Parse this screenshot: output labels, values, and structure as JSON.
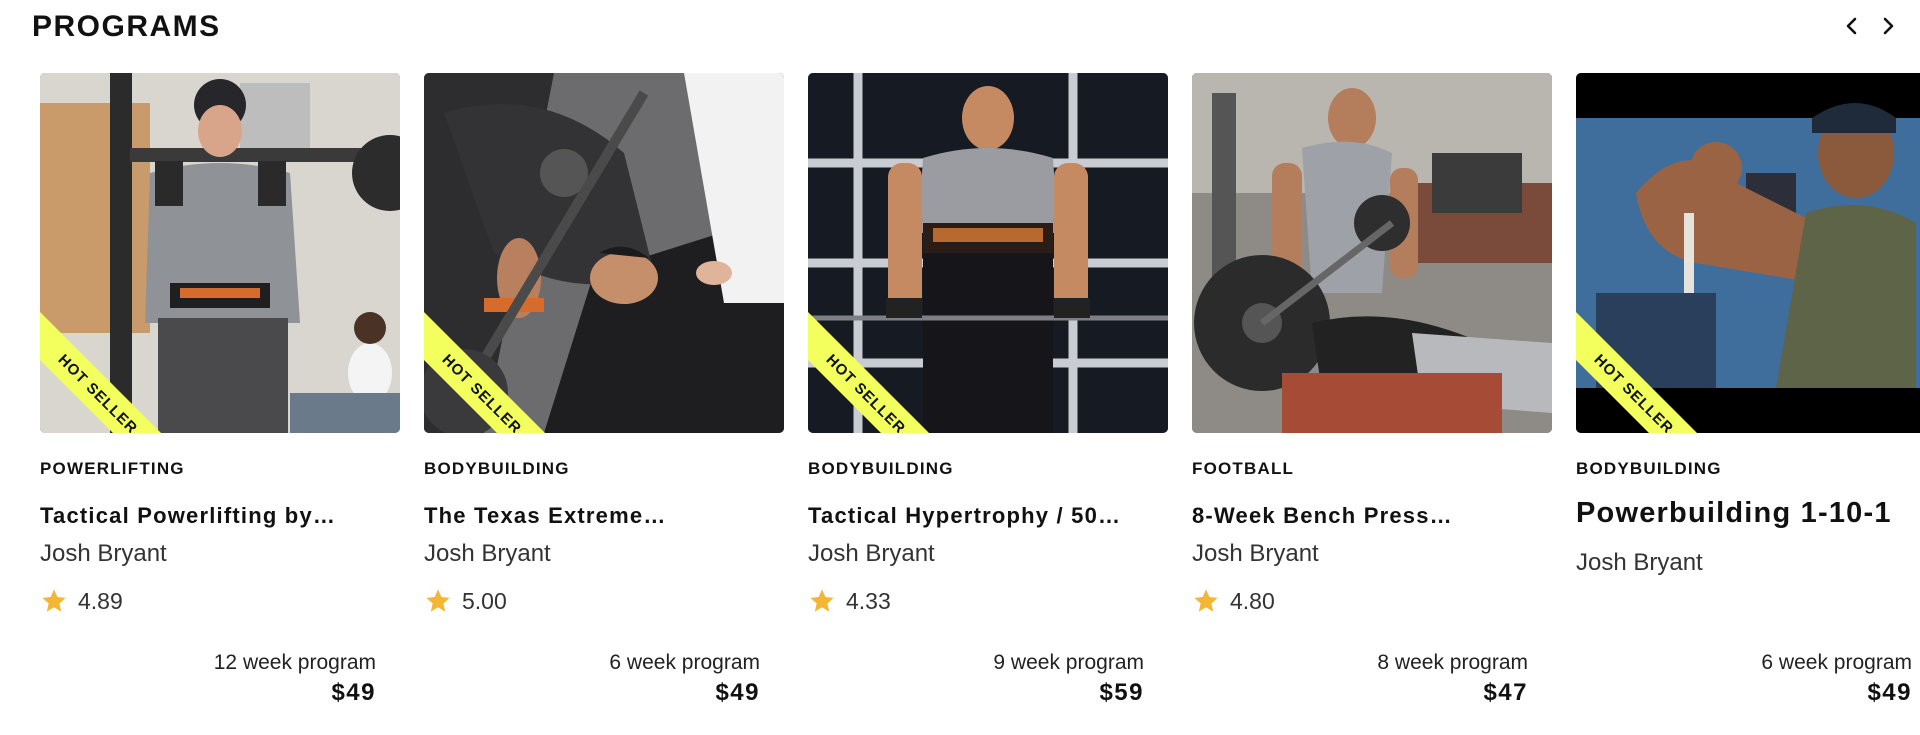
{
  "section": {
    "title": "PROGRAMS"
  },
  "nav": {
    "prev_icon": "chevron-left-icon",
    "next_icon": "chevron-right-icon"
  },
  "colors": {
    "ribbon": "#f2ff5c",
    "star": "#f5b731"
  },
  "programs": [
    {
      "badge": "HOT SELLER",
      "category": "POWERLIFTING",
      "title": "Tactical Powerlifting by…",
      "author": "Josh Bryant",
      "rating": "4.89",
      "duration": "12 week program",
      "price": "$49"
    },
    {
      "badge": "HOT SELLER",
      "category": "BODYBUILDING",
      "title": "The Texas Extreme…",
      "author": "Josh Bryant",
      "rating": "5.00",
      "duration": "6 week program",
      "price": "$49"
    },
    {
      "badge": "HOT SELLER",
      "category": "BODYBUILDING",
      "title": "Tactical Hypertrophy / 50…",
      "author": "Josh Bryant",
      "rating": "4.33",
      "duration": "9 week program",
      "price": "$59"
    },
    {
      "category": "FOOTBALL",
      "title": "8-Week Bench Press…",
      "author": "Josh Bryant",
      "rating": "4.80",
      "duration": "8 week program",
      "price": "$47"
    },
    {
      "badge": "HOT SELLER",
      "category": "BODYBUILDING",
      "title": "Powerbuilding 1-10-1",
      "author": "Josh Bryant",
      "duration": "6 week program",
      "price": "$49"
    }
  ]
}
